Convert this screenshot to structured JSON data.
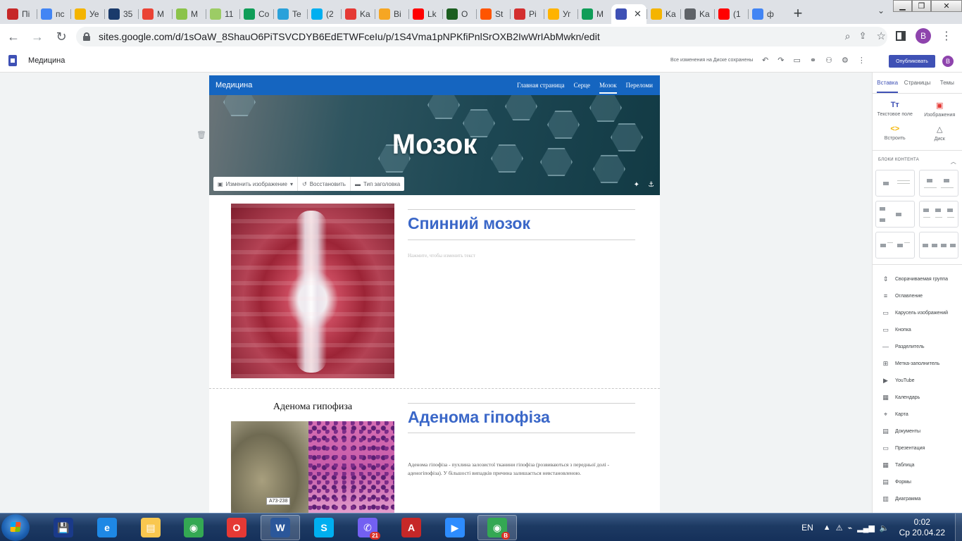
{
  "browser": {
    "tabs": [
      {
        "title": "Пі",
        "icon": "app-icon",
        "color": "#c62828"
      },
      {
        "title": "пс",
        "icon": "google-icon",
        "color": "#4285f4"
      },
      {
        "title": "Уе",
        "icon": "hand-icon",
        "color": "#f4b400"
      },
      {
        "title": "35",
        "icon": "app-icon",
        "color": "#1a3a6b"
      },
      {
        "title": "M",
        "icon": "gmail-icon",
        "color": "#ea4335"
      },
      {
        "title": "M",
        "icon": "app-icon",
        "color": "#8bc34a"
      },
      {
        "title": "11",
        "icon": "app-icon",
        "color": "#9ccc65"
      },
      {
        "title": "Co",
        "icon": "classroom-icon",
        "color": "#0f9d58"
      },
      {
        "title": "Te",
        "icon": "telegram-icon",
        "color": "#2aa1da"
      },
      {
        "title": "(2",
        "icon": "skype-icon",
        "color": "#00aff0"
      },
      {
        "title": "Ka",
        "icon": "app-icon",
        "color": "#e53935"
      },
      {
        "title": "Bi",
        "icon": "app-icon",
        "color": "#f6a623"
      },
      {
        "title": "Lk",
        "icon": "youtube-icon",
        "color": "#ff0000"
      },
      {
        "title": "O",
        "icon": "app-icon",
        "color": "#1b5e20"
      },
      {
        "title": "St",
        "icon": "soundcloud-icon",
        "color": "#ff5500"
      },
      {
        "title": "Pi",
        "icon": "app-icon",
        "color": "#d32f2f"
      },
      {
        "title": "Уг",
        "icon": "app-icon",
        "color": "#ffb300"
      },
      {
        "title": "M",
        "icon": "drive-icon",
        "color": "#0f9d58"
      },
      {
        "title": "",
        "icon": "sites-icon",
        "color": "#3f51b5",
        "active": true
      },
      {
        "title": "Ka",
        "icon": "slides-icon",
        "color": "#f4b400"
      },
      {
        "title": "Ka",
        "icon": "globe-icon",
        "color": "#5f6368"
      },
      {
        "title": "(1",
        "icon": "youtube-icon",
        "color": "#ff0000"
      },
      {
        "title": "ф",
        "icon": "google-icon",
        "color": "#4285f4"
      }
    ],
    "new_tab_glyph": "+",
    "url": "sites.google.com/d/1sOaW_8ShauO6PiTSVCDYB6EdETWFceIu/p/1S4Vma1pNPKfiPnlSrOXB2IwWrIAbMwkn/edit",
    "profile_initial": "B"
  },
  "editor": {
    "site_name": "Медицина",
    "save_status": "Все изменения на Диске сохранены",
    "publish_label": "Опубликовать",
    "profile_initial": "B"
  },
  "site": {
    "brand": "Медицина",
    "nav": [
      "Главная страница",
      "Серце",
      "Мозок",
      "Переломи"
    ],
    "current_nav": "Мозок",
    "hero_title": "Мозок",
    "hero_tools": {
      "change_image": "Изменить изображение",
      "restore": "Восстановить",
      "header_type": "Тип заголовка"
    },
    "section1": {
      "heading": "Спинний мозок",
      "placeholder": "Нажмите, чтобы изменить текст"
    },
    "section2": {
      "caption": "Аденома гипофиза",
      "heading": "Аденома гіпофіза",
      "specimen_tag": "A73-238",
      "body": "Аденома гіпофіза - пухлина залозистої тканини гіпофіза (розвиваються з передньої долі - аденогіпофіза). У більшості випадків причина залишається невстановленою."
    }
  },
  "panel": {
    "tabs": [
      "Вставка",
      "Страницы",
      "Темы"
    ],
    "active_tab": "Вставка",
    "insert_items": [
      {
        "label": "Текстовое поле",
        "icon": "Tт",
        "color": "#3f51b5"
      },
      {
        "label": "Изображения",
        "icon": "▣",
        "color": "#e53935"
      },
      {
        "label": "Встроить",
        "icon": "<>",
        "color": "#f4b400"
      },
      {
        "label": "Диск",
        "icon": "△",
        "color": "#5f6368"
      }
    ],
    "blocks_heading": "БЛОКИ КОНТЕНТА",
    "components": [
      {
        "label": "Сворачиваемая группа",
        "icon": "⇕"
      },
      {
        "label": "Оглавление",
        "icon": "≡"
      },
      {
        "label": "Карусель изображений",
        "icon": "▭"
      },
      {
        "label": "Кнопка",
        "icon": "▭"
      },
      {
        "label": "Разделитель",
        "icon": "—"
      },
      {
        "label": "Метка-заполнитель",
        "icon": "⊞"
      },
      {
        "label": "YouTube",
        "icon": "▶"
      },
      {
        "label": "Календарь",
        "icon": "▦"
      },
      {
        "label": "Карта",
        "icon": "⌖"
      },
      {
        "label": "Документы",
        "icon": "▤"
      },
      {
        "label": "Презентация",
        "icon": "▭"
      },
      {
        "label": "Таблица",
        "icon": "▦"
      },
      {
        "label": "Формы",
        "icon": "▤"
      },
      {
        "label": "Диаграмма",
        "icon": "▥"
      }
    ]
  },
  "taskbar": {
    "apps": [
      {
        "name": "save-app-icon",
        "glyph": "💾",
        "color": "#1a3a8a"
      },
      {
        "name": "internet-explorer-icon",
        "glyph": "e",
        "color": "#1e88e5"
      },
      {
        "name": "file-explorer-icon",
        "glyph": "▤",
        "color": "#f9c74f"
      },
      {
        "name": "chrome-icon",
        "glyph": "◉",
        "color": "#34a853"
      },
      {
        "name": "opera-icon",
        "glyph": "O",
        "color": "#e53935"
      },
      {
        "name": "word-icon",
        "glyph": "W",
        "color": "#2b579a",
        "pressed": true
      },
      {
        "name": "skype-icon",
        "glyph": "S",
        "color": "#00aff0"
      },
      {
        "name": "viber-icon",
        "glyph": "✆",
        "color": "#7360f2",
        "badge": "21"
      },
      {
        "name": "acrobat-icon",
        "glyph": "A",
        "color": "#c62828"
      },
      {
        "name": "zoom-icon",
        "glyph": "▶",
        "color": "#2d8cff"
      },
      {
        "name": "chrome-profile-icon",
        "glyph": "◉",
        "color": "#34a853",
        "pressed": true,
        "badge": "B"
      }
    ],
    "lang": "EN",
    "time": "0:02",
    "date": "Ср 20.04.22"
  }
}
